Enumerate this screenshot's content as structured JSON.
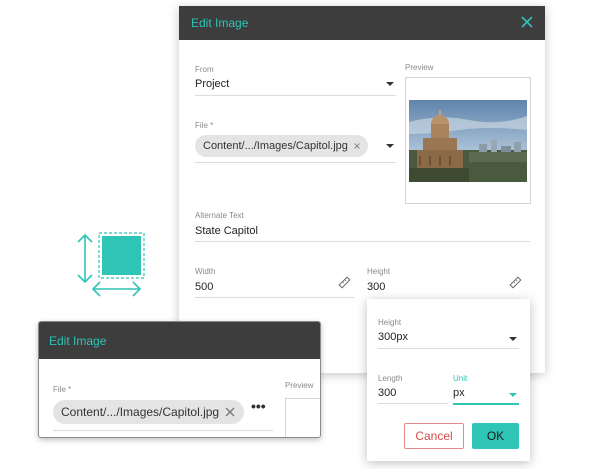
{
  "main_dialog": {
    "title": "Edit Image",
    "from_label": "From",
    "from_value": "Project",
    "preview_label": "Preview",
    "file_label": "File *",
    "file_value": "Content/.../Images/Capitol.jpg",
    "alt_label": "Alternate Text",
    "alt_value": "State Capitol",
    "width_label": "Width",
    "width_value": "500",
    "height_label": "Height",
    "height_value": "300"
  },
  "small_dialog": {
    "title": "Edit Image",
    "file_label": "File *",
    "file_value": "Content/.../Images/Capitol.jpg",
    "preview_label": "Preview",
    "more_icon": "•••"
  },
  "popover": {
    "height_label": "Height",
    "height_value": "300px",
    "length_label": "Length",
    "length_value": "300",
    "unit_label": "Unit",
    "unit_value": "px",
    "cancel_label": "Cancel",
    "ok_label": "OK"
  },
  "colors": {
    "accent": "#2ec4b6",
    "titlebar": "#3d3d3d",
    "cancel": "#d64b4b"
  },
  "icons": [
    "close-icon",
    "dropdown-caret-icon",
    "chip-remove-icon",
    "ruler-icon",
    "resize-graphic-icon",
    "more-options-icon"
  ]
}
